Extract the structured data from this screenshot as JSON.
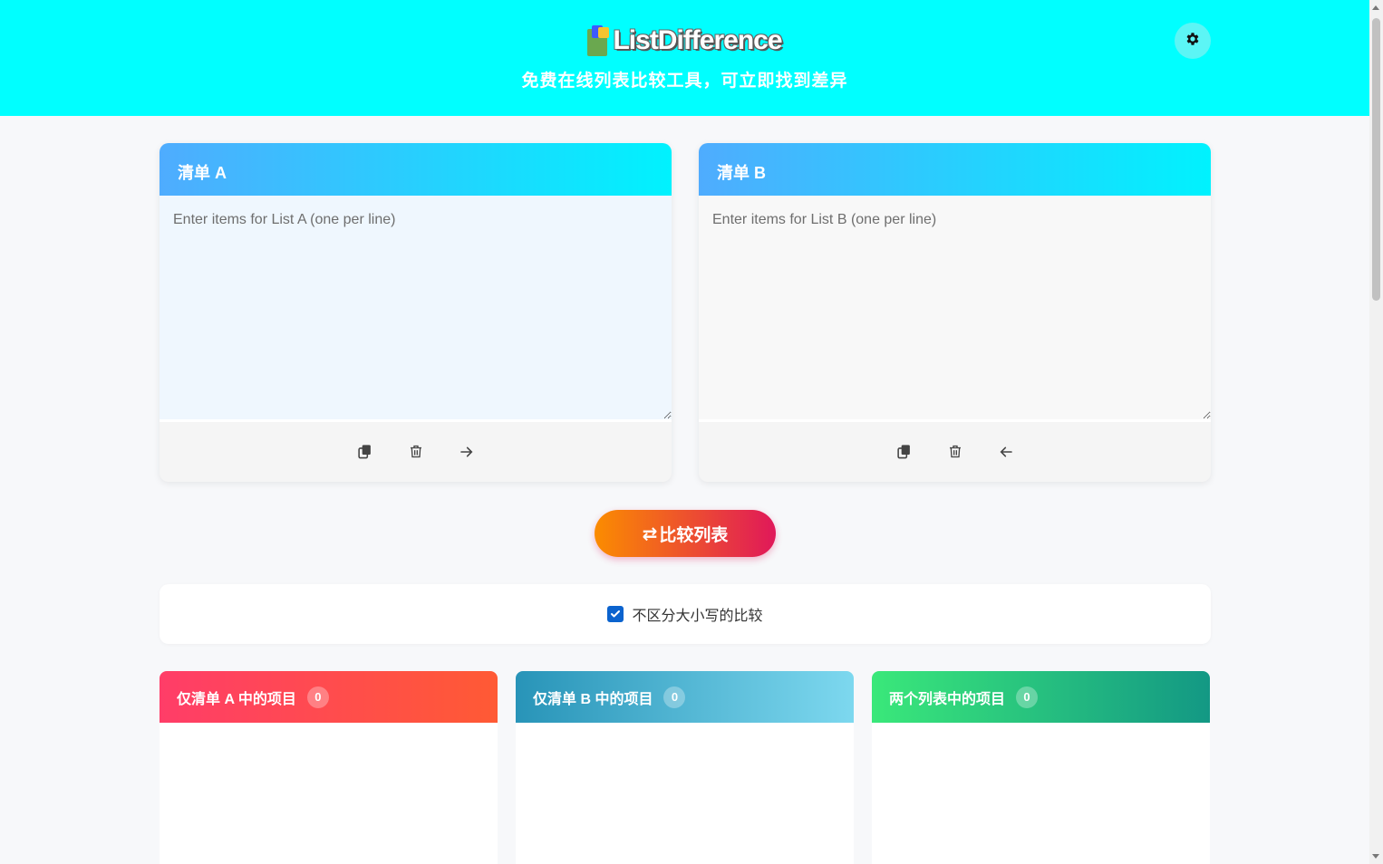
{
  "header": {
    "logo_text": "ListDifference",
    "subtitle": "免费在线列表比较工具，可立即找到差异",
    "theme_toggle_icon": "gear-icon"
  },
  "list_a": {
    "title": "清单 A",
    "placeholder": "Enter items for List A (one per line)",
    "tools": [
      "copy-icon",
      "trash-icon",
      "arrow-right-icon"
    ]
  },
  "list_b": {
    "title": "清单 B",
    "placeholder": "Enter items for List B (one per line)",
    "tools": [
      "copy-icon",
      "trash-icon",
      "arrow-left-icon"
    ]
  },
  "compare": {
    "icon": "⇄",
    "label": "比较列表"
  },
  "options": {
    "case_insensitive_label": "不区分大小写的比较",
    "case_insensitive_checked": true
  },
  "results": {
    "only_a": {
      "title": "仅清单 A 中的项目",
      "count": "0"
    },
    "only_b": {
      "title": "仅清单 B 中的项目",
      "count": "0"
    },
    "both": {
      "title": "两个列表中的项目",
      "count": "0"
    }
  },
  "colors": {
    "header_bg": "#00ffff",
    "accent_blue": "#4facfe",
    "compare_start": "#fb8c00",
    "compare_end": "#e0185a",
    "checkbox": "#0b63ce"
  }
}
